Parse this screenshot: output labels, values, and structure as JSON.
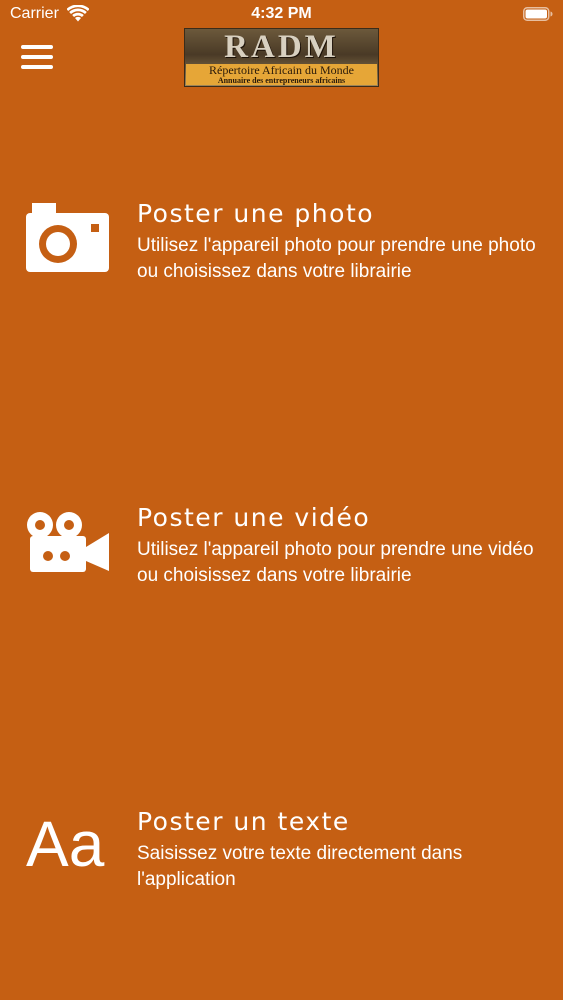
{
  "status_bar": {
    "carrier": "Carrier",
    "time": "4:32 PM"
  },
  "header": {
    "logo": {
      "title": "RADM",
      "subtitle": "Répertoire Africain du Monde",
      "tagline": "Annuaire des entrepreneurs africains"
    }
  },
  "options": [
    {
      "title": "Poster une photo",
      "description": "Utilisez l'appareil photo pour prendre une photo ou choisissez dans votre librairie",
      "icon": "camera-icon"
    },
    {
      "title": "Poster une vidéo",
      "description": "Utilisez l'appareil photo pour prendre une vidéo ou choisissez dans votre librairie",
      "icon": "video-camera-icon"
    },
    {
      "title": "Poster un texte",
      "description": "Saisissez votre texte directement dans l'application",
      "icon": "text-icon",
      "icon_text": "Aa"
    }
  ],
  "colors": {
    "background": "#c55f13",
    "text": "#ffffff",
    "logo_band": "#e6a637"
  }
}
